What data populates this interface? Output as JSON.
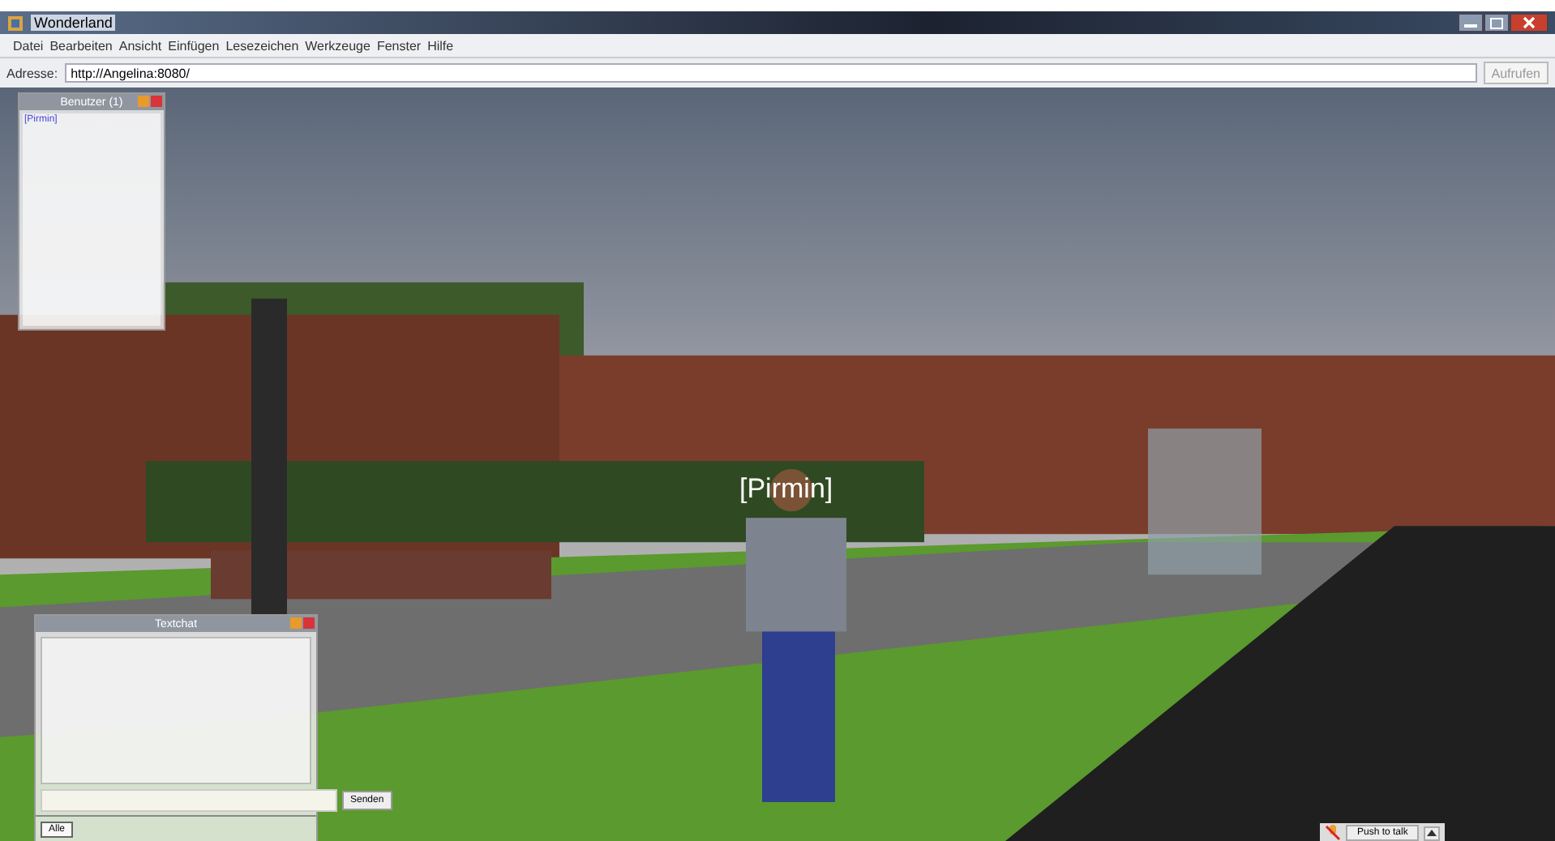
{
  "window": {
    "title": "Wonderland"
  },
  "menu": [
    "Datei",
    "Bearbeiten",
    "Ansicht",
    "Einfügen",
    "Lesezeichen",
    "Werkzeuge",
    "Fenster",
    "Hilfe"
  ],
  "address": {
    "label": "Adresse:",
    "value": "http://Angelina:8080/",
    "button": "Aufrufen"
  },
  "users_panel": {
    "title": "Benutzer (1)",
    "users": [
      "[Pirmin]"
    ]
  },
  "avatar_name": "[Pirmin]",
  "chat_panel": {
    "title": "Textchat",
    "send": "Senden",
    "tabs": [
      {
        "label": "Alle",
        "selected": true
      }
    ]
  },
  "push_to_talk": "Push to talk"
}
